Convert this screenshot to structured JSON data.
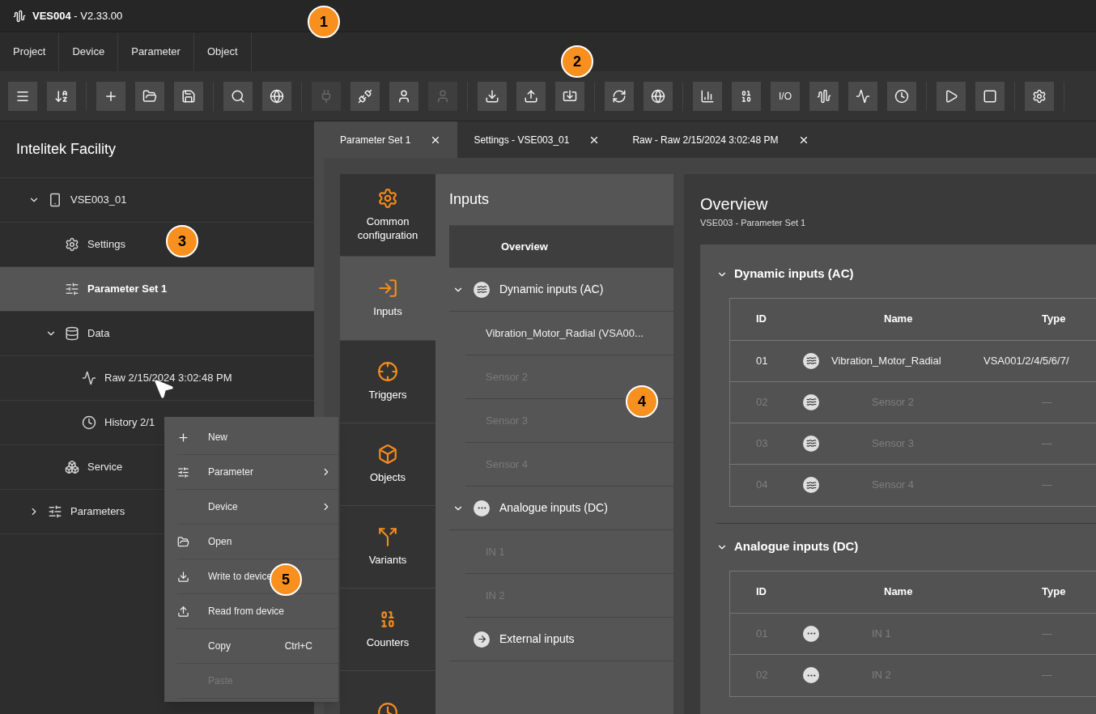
{
  "window": {
    "title": "VES004",
    "version": " - V2.33.00"
  },
  "menu": [
    {
      "label": "Project"
    },
    {
      "label": "Device"
    },
    {
      "label": "Parameter"
    },
    {
      "label": "Object"
    }
  ],
  "toolbar": [
    [
      {
        "disabled": false
      },
      {
        "disabled": false
      }
    ],
    [
      {
        "disabled": false
      },
      {
        "disabled": false
      },
      {
        "disabled": false
      }
    ],
    [
      {
        "disabled": false
      },
      {
        "disabled": false
      }
    ],
    [
      {
        "disabled": true
      },
      {
        "disabled": false
      },
      {
        "disabled": false
      },
      {
        "disabled": true
      }
    ],
    [
      {
        "disabled": false
      },
      {
        "disabled": false
      },
      {
        "disabled": false
      }
    ],
    [
      {
        "disabled": false
      },
      {
        "disabled": false
      }
    ],
    [
      {
        "disabled": false
      },
      {
        "disabled": false
      },
      {
        "disabled": false,
        "label": "I/O"
      },
      {
        "disabled": false
      },
      {
        "disabled": false
      },
      {
        "disabled": false
      }
    ],
    [
      {
        "disabled": false
      },
      {
        "disabled": false
      }
    ],
    [
      {
        "disabled": false
      }
    ]
  ],
  "project": {
    "title": "Intelitek Facility",
    "tree": [
      {
        "label": "VSE003_01",
        "expanded": true,
        "selected": false,
        "children": [
          {
            "label": "Settings",
            "selected": false
          },
          {
            "label": "Parameter Set 1",
            "selected": true
          },
          {
            "label": "Data",
            "expanded": true,
            "selected": false,
            "children": [
              {
                "label": "Raw 2/15/2024 3:02:48 PM",
                "selected": false
              },
              {
                "label": "History 2/1",
                "selected": false
              }
            ]
          },
          {
            "label": "Service",
            "selected": false
          }
        ]
      },
      {
        "label": "Parameters",
        "expanded": false,
        "selected": false
      }
    ]
  },
  "context_menu": [
    {
      "label": "New",
      "submenu": false,
      "disabled": false
    },
    {
      "label": "Parameter",
      "submenu": true,
      "disabled": false
    },
    {
      "label": "Device",
      "submenu": true,
      "disabled": false
    },
    {
      "label": "Open",
      "submenu": false,
      "disabled": false
    },
    {
      "label": "Write to device",
      "submenu": false,
      "disabled": false
    },
    {
      "label": "Read from device",
      "submenu": false,
      "disabled": false
    },
    {
      "label": "Copy",
      "shortcut": "Ctrl+C",
      "submenu": false,
      "disabled": false
    },
    {
      "label": "Paste",
      "submenu": false,
      "disabled": true
    }
  ],
  "tabs": [
    {
      "label": "Parameter Set 1",
      "selected": true
    },
    {
      "label": "Settings - VSE003_01",
      "selected": false
    },
    {
      "label": "Raw - Raw 2/15/2024 3:02:48 PM",
      "selected": false
    }
  ],
  "categories": [
    {
      "label": "Common configuration",
      "selected": false
    },
    {
      "label": "Inputs",
      "selected": true
    },
    {
      "label": "Triggers",
      "selected": false
    },
    {
      "label": "Objects",
      "selected": false
    },
    {
      "label": "Variants",
      "selected": false
    },
    {
      "label": "Counters",
      "selected": false
    },
    {
      "selected": false
    }
  ],
  "inputs": {
    "title": "Inputs",
    "overview": {
      "label": "Overview",
      "selected": true
    },
    "groups": [
      {
        "kind": "ac",
        "label": "Dynamic inputs (AC)",
        "expanded": true,
        "items": [
          {
            "label": "Vibration_Motor_Radial (VSA00...",
            "disabled": false
          },
          {
            "label": "Sensor 2",
            "disabled": true
          },
          {
            "label": "Sensor 3",
            "disabled": true
          },
          {
            "label": "Sensor 4",
            "disabled": true
          }
        ]
      },
      {
        "kind": "dc",
        "label": "Analogue inputs (DC)",
        "expanded": true,
        "items": [
          {
            "label": "IN 1",
            "disabled": true
          },
          {
            "label": "IN 2",
            "disabled": true
          }
        ]
      },
      {
        "kind": "external",
        "label": "External inputs"
      }
    ]
  },
  "overview": {
    "title": "Overview",
    "subtitle": "VSE003 - Parameter Set 1",
    "sections": [
      {
        "kind": "ac",
        "title": "Dynamic inputs (AC)",
        "expanded": true,
        "columns": [
          "ID",
          "Name",
          "Type"
        ],
        "rows": [
          {
            "id": "01",
            "name": "Vibration_Motor_Radial",
            "type": "VSA001/2/4/5/6/7/",
            "disabled": false
          },
          {
            "id": "02",
            "name": "Sensor 2",
            "type": "—",
            "disabled": true
          },
          {
            "id": "03",
            "name": "Sensor 3",
            "type": "—",
            "disabled": true
          },
          {
            "id": "04",
            "name": "Sensor 4",
            "type": "—",
            "disabled": true
          }
        ]
      },
      {
        "kind": "dc",
        "title": "Analogue inputs (DC)",
        "expanded": true,
        "columns": [
          "ID",
          "Name",
          "Type"
        ],
        "rows": [
          {
            "id": "01",
            "name": "IN 1",
            "type": "—",
            "disabled": true
          },
          {
            "id": "02",
            "name": "IN 2",
            "type": "—",
            "disabled": true
          }
        ]
      }
    ]
  },
  "callouts": [
    "1",
    "2",
    "3",
    "4",
    "5"
  ]
}
